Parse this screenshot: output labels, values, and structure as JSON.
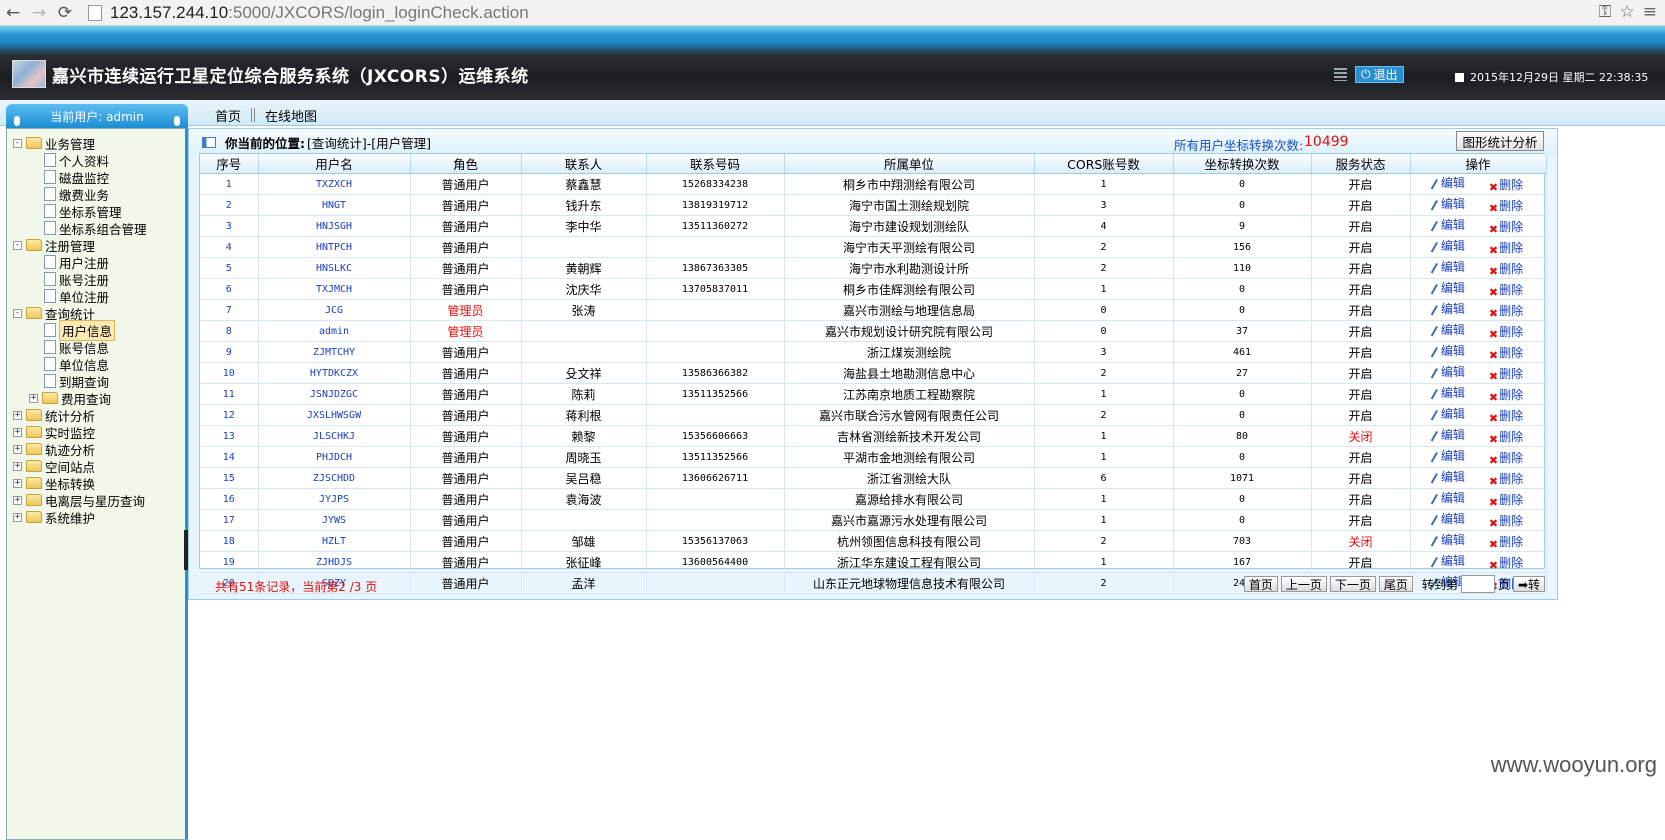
{
  "browser": {
    "url_host": "123.157.244.10",
    "url_path": ":5000/JXCORS/login_loginCheck.action"
  },
  "header": {
    "title": "嘉兴市连续运行卫星定位综合服务系统（JXCORS）运维系统",
    "logout_label": "退出",
    "datetime": "2015年12月29日 星期二 22:38:35"
  },
  "user_bar": {
    "label": "当前用户: admin"
  },
  "tabs": [
    {
      "label": "首页"
    },
    {
      "label": "在线地图"
    }
  ],
  "sidebar": {
    "items": [
      {
        "label": "业务管理",
        "level": 0,
        "expander": "−",
        "kind": "folder"
      },
      {
        "label": "个人资料",
        "level": 1,
        "kind": "page"
      },
      {
        "label": "磁盘监控",
        "level": 1,
        "kind": "page"
      },
      {
        "label": "缴费业务",
        "level": 1,
        "kind": "page"
      },
      {
        "label": "坐标系管理",
        "level": 1,
        "kind": "page"
      },
      {
        "label": "坐标系组合管理",
        "level": 1,
        "kind": "page"
      },
      {
        "label": "注册管理",
        "level": 0,
        "expander": "−",
        "kind": "folder"
      },
      {
        "label": "用户注册",
        "level": 1,
        "kind": "page"
      },
      {
        "label": "账号注册",
        "level": 1,
        "kind": "page"
      },
      {
        "label": "单位注册",
        "level": 1,
        "kind": "page"
      },
      {
        "label": "查询统计",
        "level": 0,
        "expander": "−",
        "kind": "folder"
      },
      {
        "label": "用户信息",
        "level": 1,
        "kind": "page",
        "selected": true
      },
      {
        "label": "账号信息",
        "level": 1,
        "kind": "page"
      },
      {
        "label": "单位信息",
        "level": 1,
        "kind": "page"
      },
      {
        "label": "到期查询",
        "level": 1,
        "kind": "page"
      },
      {
        "label": "费用查询",
        "level": 1,
        "expander": "+",
        "kind": "folder"
      },
      {
        "label": "统计分析",
        "level": 0,
        "expander": "+",
        "kind": "folder"
      },
      {
        "label": "实时监控",
        "level": 0,
        "expander": "+",
        "kind": "folder"
      },
      {
        "label": "轨迹分析",
        "level": 0,
        "expander": "+",
        "kind": "folder"
      },
      {
        "label": "空间站点",
        "level": 0,
        "expander": "+",
        "kind": "folder"
      },
      {
        "label": "坐标转换",
        "level": 0,
        "expander": "+",
        "kind": "folder"
      },
      {
        "label": "电离层与星历查询",
        "level": 0,
        "expander": "+",
        "kind": "folder"
      },
      {
        "label": "系统维护",
        "level": 0,
        "expander": "+",
        "kind": "folder"
      }
    ]
  },
  "location": {
    "prefix": "你当前的位置:",
    "path": "[查询统计]-[用户管理]",
    "conversion_label": "所有用户坐标转换次数:",
    "conversion_count": "10499",
    "chart_button": "图形统计分析"
  },
  "table": {
    "columns": [
      "序号",
      "用户名",
      "角色",
      "联系人",
      "联系号码",
      "所属单位",
      "CORS账号数",
      "坐标转换次数",
      "服务状态",
      "操作"
    ],
    "edit_label": "编辑",
    "delete_label": "删除",
    "rows": [
      [
        "1",
        "TXZXCH",
        "普通用户",
        "蔡鑫慧",
        "15268334238",
        "桐乡市中翔测绘有限公司",
        "1",
        "0",
        "开启"
      ],
      [
        "2",
        "HNGT",
        "普通用户",
        "钱升东",
        "13819319712",
        "海宁市国土测绘规划院",
        "3",
        "0",
        "开启"
      ],
      [
        "3",
        "HNJSGH",
        "普通用户",
        "李中华",
        "13511360272",
        "海宁市建设规划测绘队",
        "4",
        "9",
        "开启"
      ],
      [
        "4",
        "HNTPCH",
        "普通用户",
        "",
        "",
        "海宁市天平测绘有限公司",
        "2",
        "156",
        "开启"
      ],
      [
        "5",
        "HNSLKC",
        "普通用户",
        "黄朝辉",
        "13867363305",
        "海宁市水利勘测设计所",
        "2",
        "110",
        "开启"
      ],
      [
        "6",
        "TXJMCH",
        "普通用户",
        "沈庆华",
        "13705837011",
        "桐乡市佳辉测绘有限公司",
        "1",
        "0",
        "开启"
      ],
      [
        "7",
        "JCG",
        "管理员",
        "张涛",
        "",
        "嘉兴市测绘与地理信息局",
        "0",
        "0",
        "开启"
      ],
      [
        "8",
        "admin",
        "管理员",
        "",
        "",
        "嘉兴市规划设计研究院有限公司",
        "0",
        "37",
        "开启"
      ],
      [
        "9",
        "ZJMTCHY",
        "普通用户",
        "",
        "",
        "浙江煤炭测绘院",
        "3",
        "461",
        "开启"
      ],
      [
        "10",
        "HYTDKCZX",
        "普通用户",
        "殳文祥",
        "13586366382",
        "海盐县土地勘测信息中心",
        "2",
        "27",
        "开启"
      ],
      [
        "11",
        "JSNJDZGC",
        "普通用户",
        "陈莉",
        "13511352566",
        "江苏南京地质工程勘察院",
        "1",
        "0",
        "开启"
      ],
      [
        "12",
        "JXSLHWSGW",
        "普通用户",
        "蒋利根",
        "",
        "嘉兴市联合污水管网有限责任公司",
        "2",
        "0",
        "开启"
      ],
      [
        "13",
        "JLSCHKJ",
        "普通用户",
        "赖黎",
        "15356606663",
        "吉林省测绘新技术开发公司",
        "1",
        "80",
        "关闭"
      ],
      [
        "14",
        "PHJDCH",
        "普通用户",
        "周晓玉",
        "13511352566",
        "平湖市金地测绘有限公司",
        "1",
        "0",
        "开启"
      ],
      [
        "15",
        "ZJSCHDD",
        "普通用户",
        "吴吕稳",
        "13606626711",
        "浙江省测绘大队",
        "6",
        "1071",
        "开启"
      ],
      [
        "16",
        "JYJPS",
        "普通用户",
        "袁海波",
        "",
        "嘉源给排水有限公司",
        "1",
        "0",
        "开启"
      ],
      [
        "17",
        "JYWS",
        "普通用户",
        "",
        "",
        "嘉兴市嘉源污水处理有限公司",
        "1",
        "0",
        "开启"
      ],
      [
        "18",
        "HZLT",
        "普通用户",
        "邹雄",
        "15356137063",
        "杭州领图信息科技有限公司",
        "2",
        "703",
        "关闭"
      ],
      [
        "19",
        "ZJHDJS",
        "普通用户",
        "张征峰",
        "13600564400",
        "浙江华东建设工程有限公司",
        "1",
        "167",
        "开启"
      ],
      [
        "20",
        "SDZY",
        "普通用户",
        "孟洋",
        "",
        "山东正元地球物理信息技术有限公司",
        "2",
        "244",
        "关闭"
      ]
    ]
  },
  "pager": {
    "record_info": "共有51条记录，当前第2 /3 页",
    "first": "首页",
    "prev": "上一页",
    "next": "下一页",
    "last": "尾页",
    "jump_label": "转到第",
    "page_unit": "页",
    "go": "➡转"
  },
  "watermark": "www.wooyun.org",
  "colors": {
    "accent": "#1f86c4",
    "alert": "#e41010",
    "link": "#1a3fc0"
  }
}
